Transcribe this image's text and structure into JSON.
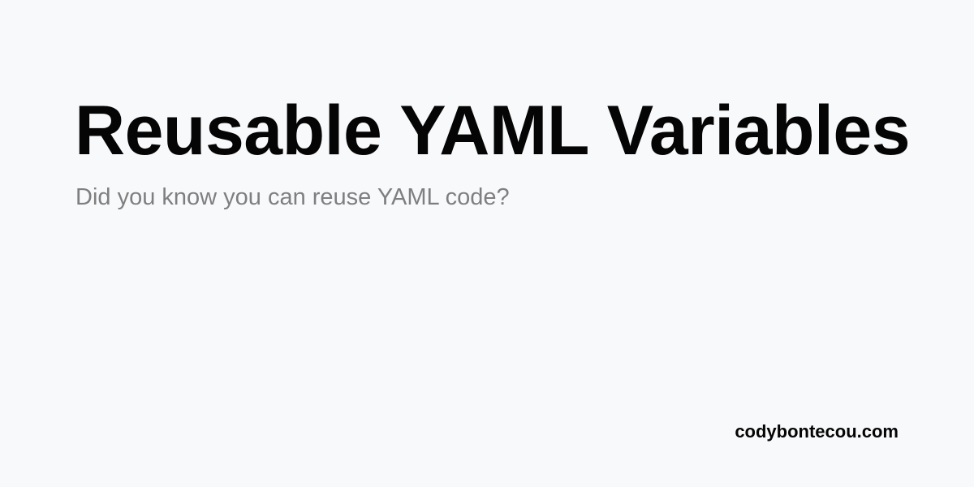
{
  "card": {
    "title": "Reusable YAML Variables",
    "subtitle": "Did you know you can reuse YAML code?",
    "site": "codybontecou.com"
  },
  "colors": {
    "background": "#f8f9fb",
    "title": "#050505",
    "subtitle": "#7f7f80",
    "site": "#050505"
  }
}
